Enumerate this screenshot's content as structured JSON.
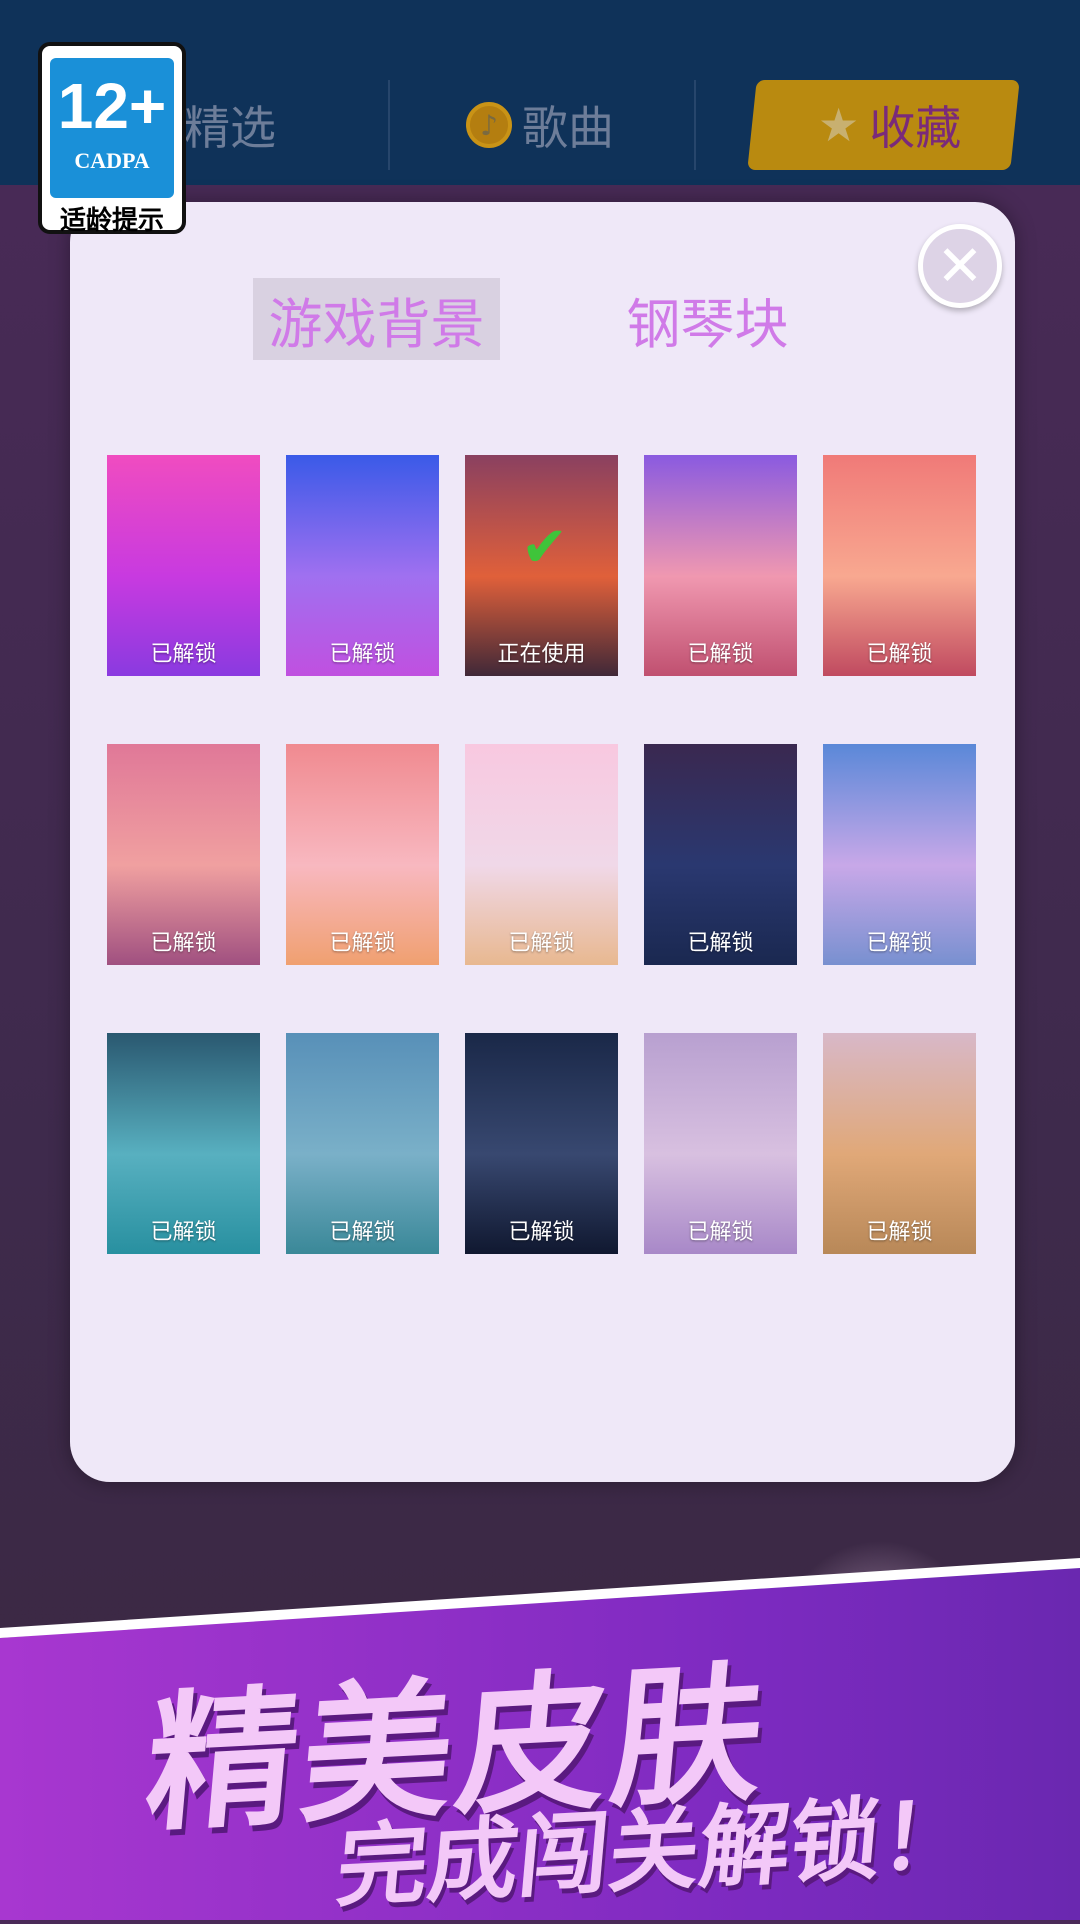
{
  "nav": {
    "tabs": [
      {
        "label": "精选"
      },
      {
        "label": "歌曲",
        "icon": "music-note-icon"
      },
      {
        "label": "收藏",
        "icon": "star-icon",
        "active": true
      }
    ]
  },
  "badge": {
    "age": "12+",
    "org": "CADPA",
    "tip": "适龄提示"
  },
  "modal": {
    "tabs": [
      {
        "label": "游戏背景",
        "active": true
      },
      {
        "label": "钢琴块"
      }
    ],
    "close_icon": "close-icon"
  },
  "backgrounds": [
    {
      "label": "已解锁",
      "colors": [
        "#f04cc0",
        "#c83ae0",
        "#8a3ae0"
      ]
    },
    {
      "label": "已解锁",
      "colors": [
        "#3a5ae8",
        "#a070f0",
        "#c050e0"
      ]
    },
    {
      "label": "正在使用",
      "colors": [
        "#8a4060",
        "#e0603a",
        "#402838"
      ],
      "selected": true
    },
    {
      "label": "已解锁",
      "colors": [
        "#8a5ae0",
        "#f098b0",
        "#c05070"
      ]
    },
    {
      "label": "已解锁",
      "colors": [
        "#f07a78",
        "#f8a890",
        "#c04a60"
      ]
    },
    {
      "label": "已解锁",
      "colors": [
        "#e07898",
        "#f0a0a0",
        "#a05080"
      ]
    },
    {
      "label": "已解锁",
      "colors": [
        "#f08a90",
        "#f8b8c0",
        "#f0a070"
      ]
    },
    {
      "label": "已解锁",
      "colors": [
        "#f8c8e0",
        "#f0d8e8",
        "#e8b890"
      ]
    },
    {
      "label": "已解锁",
      "colors": [
        "#3a2850",
        "#2a3870",
        "#1a2850"
      ]
    },
    {
      "label": "已解锁",
      "colors": [
        "#5a88d8",
        "#c8a8e8",
        "#7890d0"
      ]
    },
    {
      "label": "已解锁",
      "colors": [
        "#2a5870",
        "#58b0c0",
        "#2890a0"
      ]
    },
    {
      "label": "已解锁",
      "colors": [
        "#5890b8",
        "#7ab0c8",
        "#3a8898"
      ]
    },
    {
      "label": "已解锁",
      "colors": [
        "#1a2848",
        "#384870",
        "#101830"
      ]
    },
    {
      "label": "已解锁",
      "colors": [
        "#b8a0d0",
        "#d8c0e0",
        "#a888c8"
      ]
    },
    {
      "label": "已解锁",
      "colors": [
        "#d8b8c8",
        "#e0a878",
        "#b88858"
      ]
    }
  ],
  "banner": {
    "title": "精美皮肤",
    "subtitle": "完成闯关解锁！"
  }
}
